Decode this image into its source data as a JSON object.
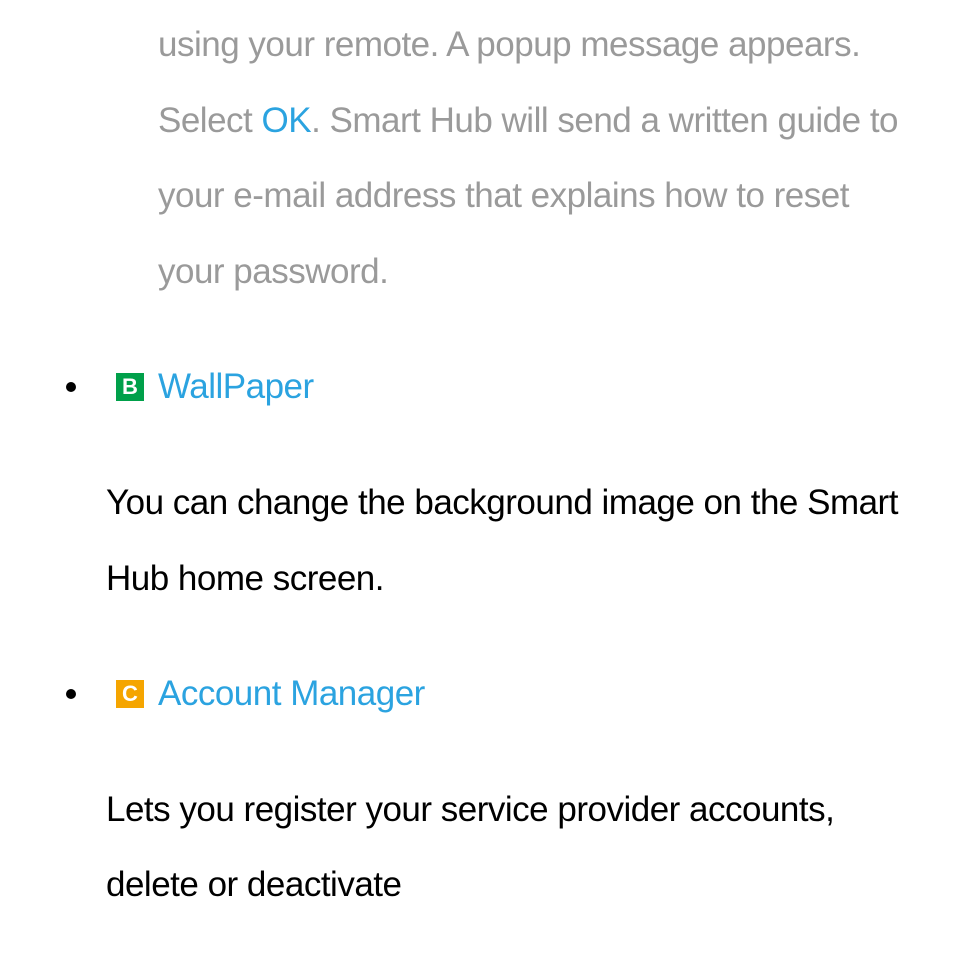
{
  "colors": {
    "muted": "#9a9a9a",
    "accent": "#2ba3e0",
    "badge_b": "#00a04a",
    "badge_c": "#f5a500"
  },
  "top": {
    "prefix": "using your remote. A popup message appears. Select ",
    "highlight": "OK",
    "suffix": ". Smart Hub will send a written guide to your e-mail address that explains how to reset your password."
  },
  "sections": [
    {
      "badge": "B",
      "title": "WallPaper",
      "body": "You can change the background image on the Smart Hub home screen."
    },
    {
      "badge": "C",
      "title": "Account Manager",
      "body": "Lets you register your service provider accounts, delete or deactivate"
    }
  ]
}
